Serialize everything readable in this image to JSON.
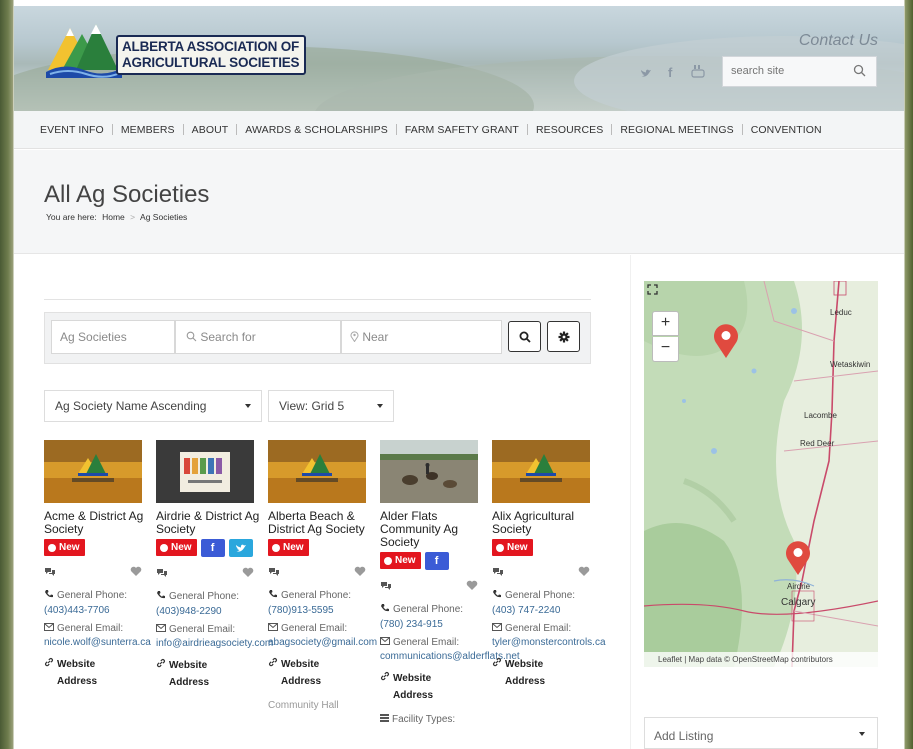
{
  "header": {
    "logo_text": "ALBERTA ASSOCIATION OF AGRICULTURAL SOCIETIES",
    "contact_label": "Contact Us",
    "search_placeholder": "search site"
  },
  "nav": {
    "items": [
      {
        "label": "EVENT INFO"
      },
      {
        "label": "MEMBERS"
      },
      {
        "label": "ABOUT"
      },
      {
        "label": "AWARDS & SCHOLARSHIPS"
      },
      {
        "label": "FARM SAFETY GRANT"
      },
      {
        "label": "RESOURCES"
      },
      {
        "label": "REGIONAL MEETINGS"
      },
      {
        "label": "CONVENTION"
      }
    ]
  },
  "page": {
    "title": "All Ag Societies",
    "breadcrumb": {
      "prefix": "You are here:",
      "home": "Home",
      "sep": ">",
      "current": "Ag Societies"
    }
  },
  "filters": {
    "type_value": "Ag Societies",
    "search_placeholder": "Search for",
    "near_placeholder": "Near",
    "sort_value": "Ag Society Name Ascending",
    "view_value": "View: Grid 5"
  },
  "badges": {
    "new": "New",
    "fb": "f"
  },
  "labels": {
    "phone": "General Phone:",
    "email": "General Email:",
    "website": "Website",
    "address": "Address",
    "facility_types": "Facility Types:",
    "community_hall": "Community Hall"
  },
  "listings": [
    {
      "name": "Acme & District Ag Society",
      "phone": "(403)443-7706",
      "email": "nicole.wolf@sunterra.ca"
    },
    {
      "name": "Airdrie & District Ag Society",
      "phone": "(403)948-2290",
      "email": "info@airdrieagsociety.com"
    },
    {
      "name": "Alberta Beach & District Ag Society",
      "phone": "(780)913-5595",
      "email": "abagsociety@gmail.com"
    },
    {
      "name": "Alder Flats Community Ag Society",
      "phone": "(780) 234-915",
      "email": "communications@alderflats.net"
    },
    {
      "name": "Alix Agricultural Society",
      "phone": "(403) 747-2240",
      "email": "tyler@monstercontrols.ca"
    }
  ],
  "map": {
    "zoom_in": "+",
    "zoom_out": "−",
    "cities": [
      "Leduc",
      "Wetaskiwin",
      "Lacombe",
      "Red Deer",
      "Airdrie",
      "Calgary"
    ],
    "attribution": "Leaflet | Map data © OpenStreetMap contributors"
  },
  "sidebar": {
    "add_listing": "Add Listing"
  },
  "colors": {
    "new_badge": "#e3161f",
    "facebook": "#3b5bd6",
    "twitter": "#2aa7dd",
    "map_pin": "#e04a3f",
    "link": "#3a6a96"
  }
}
